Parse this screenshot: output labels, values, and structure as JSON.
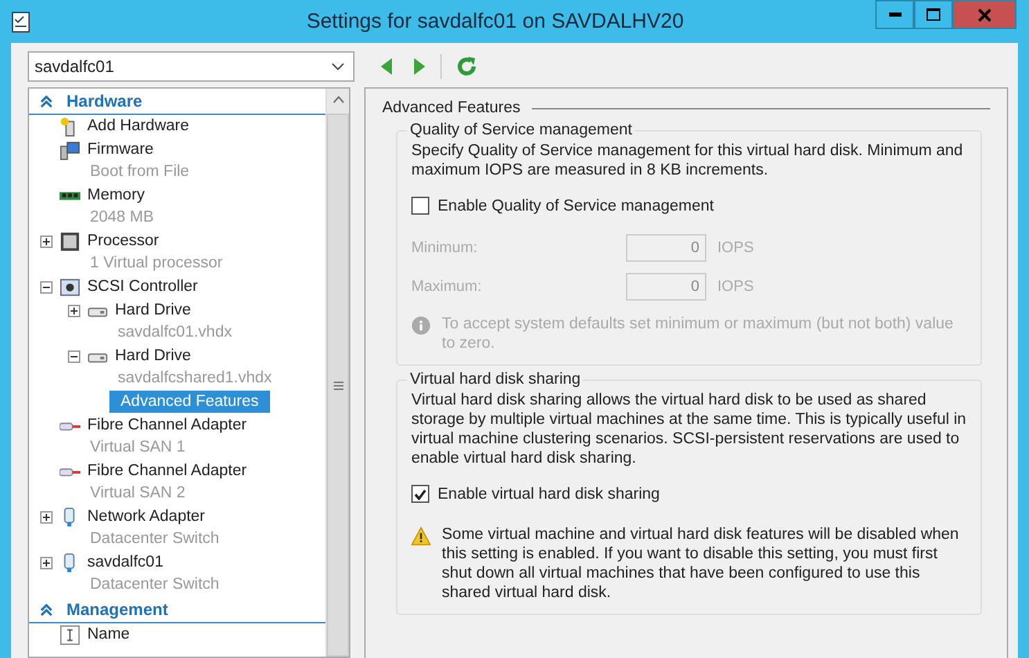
{
  "window": {
    "title": "Settings for savdalfc01 on SAVDALHV20"
  },
  "vm_selector": {
    "value": "savdalfc01"
  },
  "sidebar": {
    "sections": [
      {
        "title": "Hardware",
        "expanded": true,
        "items": [
          {
            "kind": "add-hardware",
            "label": "Add Hardware",
            "selected": false
          },
          {
            "kind": "firmware",
            "label": "Firmware",
            "detail": "Boot from File",
            "selected": false
          },
          {
            "kind": "memory",
            "label": "Memory",
            "detail": "2048 MB",
            "selected": false
          },
          {
            "kind": "processor",
            "label": "Processor",
            "detail": "1 Virtual processor",
            "expanded": false,
            "selected": false
          },
          {
            "kind": "controller",
            "label": "SCSI Controller",
            "expanded": true,
            "selected": false,
            "children": [
              {
                "kind": "drive",
                "label": "Hard Drive",
                "detail": "savdalfc01.vhdx",
                "expanded": false,
                "selected": false
              },
              {
                "kind": "drive",
                "label": "Hard Drive",
                "detail": "savdalfcshared1.vhdx",
                "expanded": true,
                "selected": false,
                "children": [
                  {
                    "kind": "feature",
                    "label": "Advanced Features",
                    "selected": true
                  }
                ]
              }
            ]
          },
          {
            "kind": "fibre",
            "label": "Fibre Channel Adapter",
            "detail": "Virtual SAN 1",
            "selected": false
          },
          {
            "kind": "fibre",
            "label": "Fibre Channel Adapter",
            "detail": "Virtual SAN 2",
            "selected": false
          },
          {
            "kind": "network",
            "label": "Network Adapter",
            "detail": "Datacenter Switch",
            "expanded": false,
            "selected": false
          },
          {
            "kind": "network",
            "label": "savdalfc01",
            "detail": "Datacenter Switch",
            "expanded": false,
            "selected": false
          }
        ]
      },
      {
        "title": "Management",
        "expanded": true,
        "items": [
          {
            "kind": "name",
            "label": "Name",
            "selected": false
          }
        ]
      }
    ]
  },
  "panel": {
    "title": "Advanced Features",
    "groups": [
      {
        "title": "Quality of Service management",
        "description": "Specify Quality of Service management for this virtual hard disk. Minimum and maximum IOPS are measured in 8 KB increments.",
        "checkbox": {
          "label": "Enable Quality of Service management",
          "checked": false
        },
        "fields": [
          {
            "label": "Minimum:",
            "value": "0",
            "unit": "IOPS",
            "disabled": true
          },
          {
            "label": "Maximum:",
            "value": "0",
            "unit": "IOPS",
            "disabled": true
          }
        ],
        "note": {
          "kind": "info",
          "text": "To accept system defaults set minimum or maximum (but not both) value to zero.",
          "disabled": true
        }
      },
      {
        "title": "Virtual hard disk sharing",
        "description": "Virtual hard disk sharing allows the virtual hard disk to be used as shared storage by multiple virtual machines at the same time. This is typically useful in virtual machine clustering scenarios. SCSI-persistent reservations are used to enable virtual hard disk sharing.",
        "checkbox": {
          "label": "Enable virtual hard disk sharing",
          "checked": true
        },
        "note": {
          "kind": "warning",
          "text": "Some virtual machine and virtual hard disk features will be disabled when this setting is enabled. If you want to disable this setting, you must first shut down all virtual machines that have been configured to use this shared virtual hard disk.",
          "disabled": false
        }
      }
    ]
  }
}
